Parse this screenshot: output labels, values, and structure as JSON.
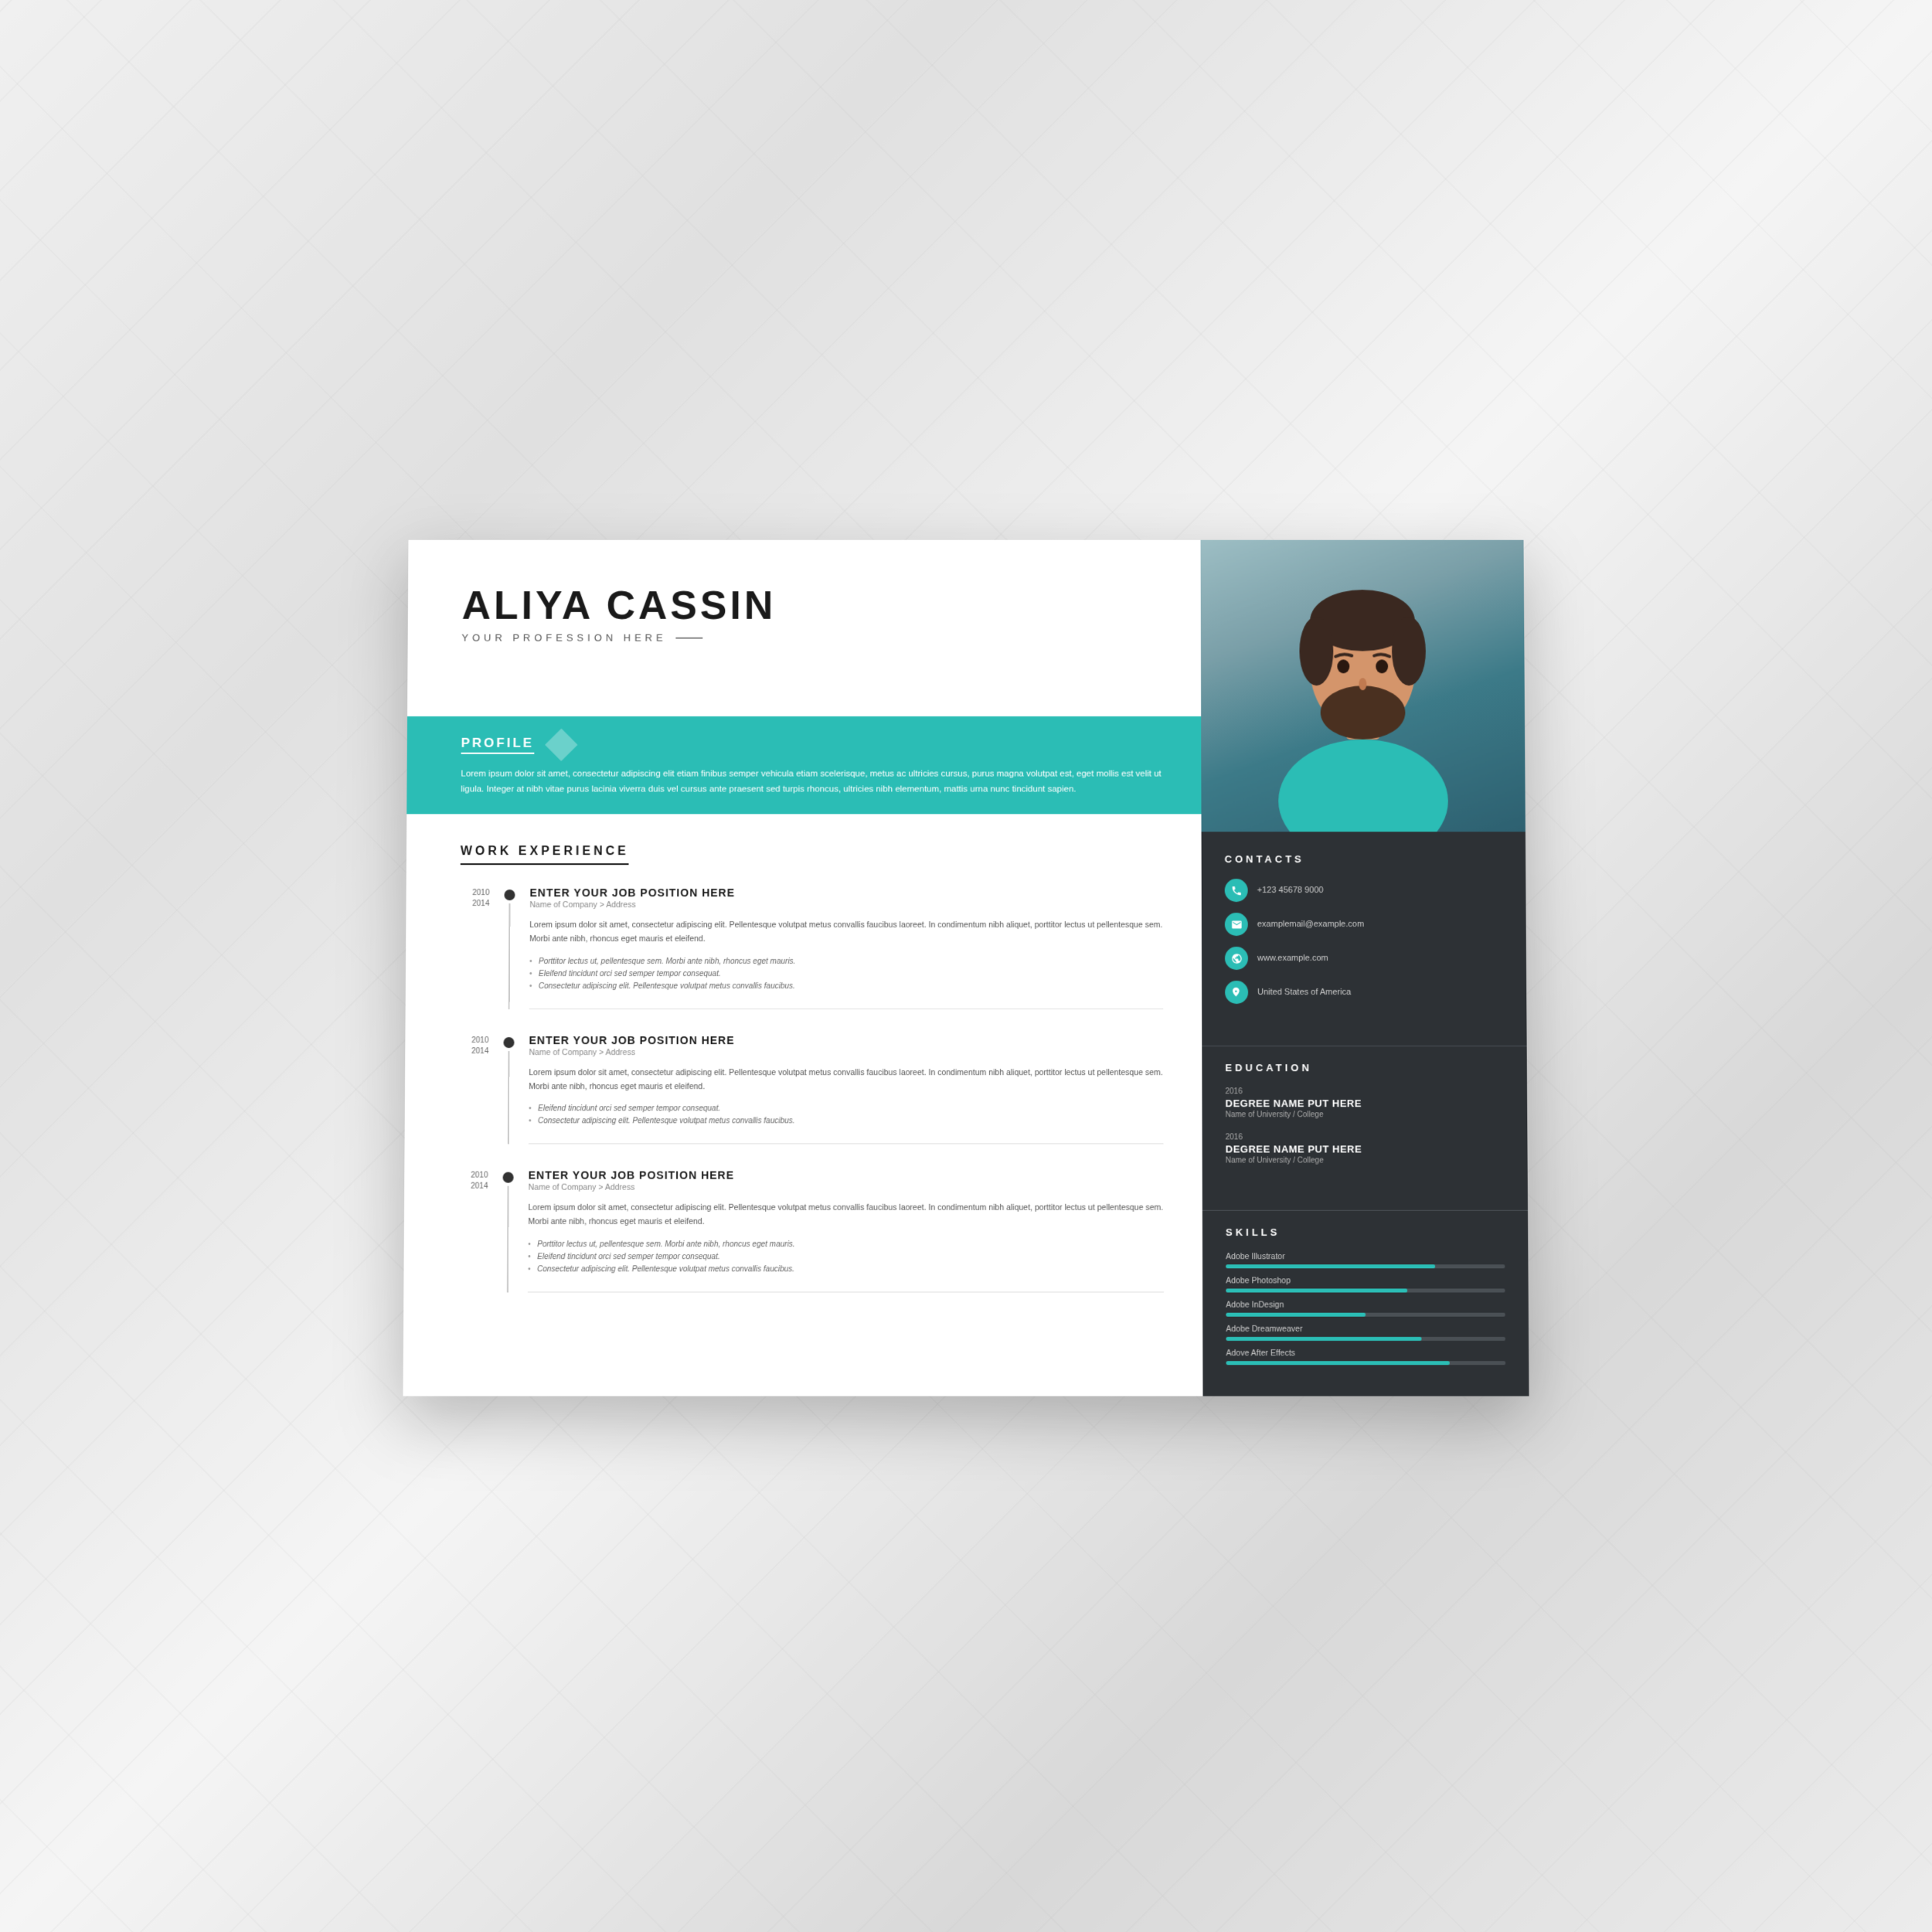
{
  "resume": {
    "name": "ALIYA CASSIN",
    "profession": "YOUR PROFESSION HERE",
    "profile": {
      "title": "PROFILE",
      "text": "Lorem ipsum dolor sit amet, consectetur adipiscing elit etiam finibus semper vehicula etiam scelerisque, metus ac ultricies cursus, purus magna volutpat est, eget mollis est velit ut ligula. Integer at nibh vitae purus lacinia viverra duis vel cursus ante praesent sed turpis rhoncus, ultricies nibh elementum, mattis urna nunc tincidunt sapien."
    },
    "work_experience": {
      "title": "WORK EXPERIENCE",
      "jobs": [
        {
          "year_start": "2010",
          "year_end": "2014",
          "title": "ENTER YOUR JOB POSITION HERE",
          "company": "Name of Company > Address",
          "description": "Lorem ipsum dolor sit amet, consectetur adipiscing elit. Pellentesque volutpat metus convallis faucibus laoreet. In condimentum nibh aliquet, porttitor lectus ut pellentesque sem. Morbi ante nibh, rhoncus eget mauris et eleifend.",
          "bullets": [
            "Porttitor lectus ut, pellentesque sem. Morbi ante nibh, rhoncus eget mauris.",
            "Eleifend tincidunt orci sed semper tempor consequat.",
            "Consectetur adipiscing elit. Pellentesque volutpat metus convallis faucibus."
          ]
        },
        {
          "year_start": "2010",
          "year_end": "2014",
          "title": "ENTER YOUR JOB POSITION HERE",
          "company": "Name of Company > Address",
          "description": "Lorem ipsum dolor sit amet, consectetur adipiscing elit. Pellentesque volutpat metus convallis faucibus laoreet. In condimentum nibh aliquet, porttitor lectus ut pellentesque sem. Morbi ante nibh, rhoncus eget mauris et eleifend.",
          "bullets": [
            "Eleifend tincidunt orci sed semper tempor consequat.",
            "Consectetur adipiscing elit. Pellentesque volutpat metus convallis faucibus."
          ]
        },
        {
          "year_start": "2010",
          "year_end": "2014",
          "title": "ENTER YOUR JOB POSITION HERE",
          "company": "Name of Company > Address",
          "description": "Lorem ipsum dolor sit amet, consectetur adipiscing elit. Pellentesque volutpat metus convallis faucibus laoreet. In condimentum nibh aliquet, porttitor lectus ut pellentesque sem. Morbi ante nibh, rhoncus eget mauris et eleifend.",
          "bullets": [
            "Porttitor lectus ut, pellentesque sem. Morbi ante nibh, rhoncus eget mauris.",
            "Eleifend tincidunt orci sed semper tempor consequat.",
            "Consectetur adipiscing elit. Pellentesque volutpat metus convallis faucibus."
          ]
        }
      ]
    },
    "contacts": {
      "title": "CONTACTS",
      "items": [
        {
          "icon": "phone",
          "text": "+123 45678 9000"
        },
        {
          "icon": "email",
          "text": "examplemail@example.com"
        },
        {
          "icon": "web",
          "text": "www.example.com"
        },
        {
          "icon": "location",
          "text": "United States of America"
        }
      ]
    },
    "education": {
      "title": "EDUCATION",
      "entries": [
        {
          "year": "2016",
          "degree": "DEGREE NAME PUT HERE",
          "school": "Name of University / College"
        },
        {
          "year": "2016",
          "degree": "DEGREE NAME PUT HERE",
          "school": "Name of University / College"
        }
      ]
    },
    "skills": {
      "title": "SKILLS",
      "items": [
        {
          "name": "Adobe Illustrator",
          "percent": 75
        },
        {
          "name": "Adobe Photoshop",
          "percent": 65
        },
        {
          "name": "Adobe InDesign",
          "percent": 50
        },
        {
          "name": "Adobe Dreamweaver",
          "percent": 70
        },
        {
          "name": "Adove After Effects",
          "percent": 80
        }
      ]
    }
  }
}
